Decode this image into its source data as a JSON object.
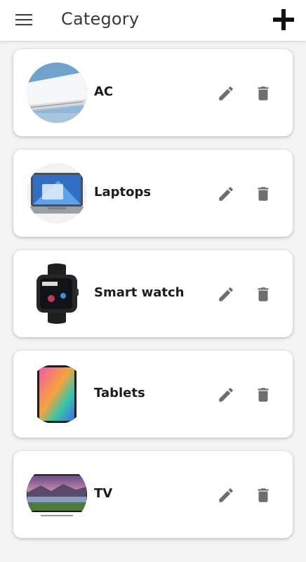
{
  "header": {
    "title": "Category",
    "menu_icon": "menu-icon",
    "add_icon": "add-icon"
  },
  "categories": [
    {
      "label": "AC",
      "image": "air-conditioner-image"
    },
    {
      "label": "Laptops",
      "image": "laptop-image"
    },
    {
      "label": "Smart watch",
      "image": "smartwatch-image"
    },
    {
      "label": "Tablets",
      "image": "tablet-image"
    },
    {
      "label": "TV",
      "image": "tv-image"
    }
  ],
  "actions": {
    "edit_icon": "pencil-icon",
    "delete_icon": "trash-icon"
  },
  "colors": {
    "background": "#f4f4f4",
    "card": "#ffffff",
    "icon_gray": "#6e6e6e",
    "text": "#1c1c1c"
  }
}
